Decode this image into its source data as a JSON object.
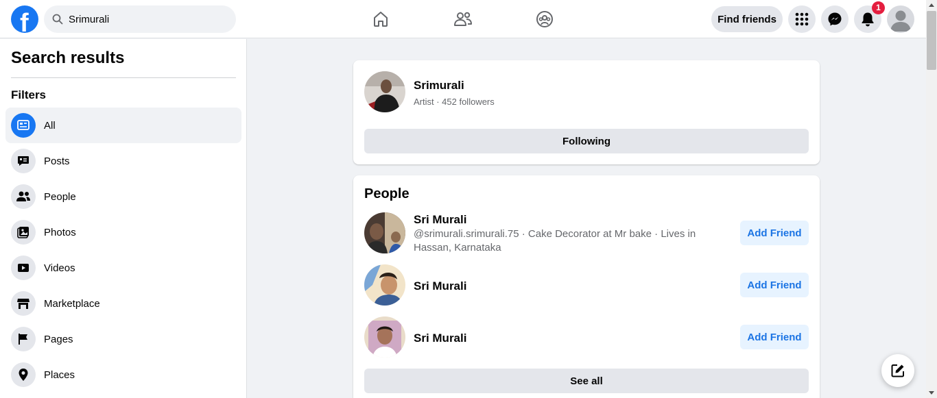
{
  "header": {
    "search_value": "Srimurali",
    "logo_letter": "f",
    "find_friends_label": "Find friends",
    "notification_count": "1"
  },
  "sidebar": {
    "title": "Search results",
    "filters_label": "Filters",
    "items": [
      {
        "label": "All",
        "icon": "feed-icon"
      },
      {
        "label": "Posts",
        "icon": "posts-icon"
      },
      {
        "label": "People",
        "icon": "people-icon"
      },
      {
        "label": "Photos",
        "icon": "photos-icon"
      },
      {
        "label": "Videos",
        "icon": "videos-icon"
      },
      {
        "label": "Marketplace",
        "icon": "marketplace-icon"
      },
      {
        "label": "Pages",
        "icon": "pages-icon"
      },
      {
        "label": "Places",
        "icon": "places-icon"
      }
    ]
  },
  "main": {
    "page_result": {
      "name": "Srimurali",
      "subtitle": "Artist · 452 followers",
      "button_label": "Following"
    },
    "people": {
      "title": "People",
      "results": [
        {
          "name": "Sri Murali",
          "detail": "@srimurali.srimurali.75 · Cake Decorator at Mr bake · Lives in Hassan, Karnataka",
          "button_label": "Add Friend"
        },
        {
          "name": "Sri Murali",
          "detail": "",
          "button_label": "Add Friend"
        },
        {
          "name": "Sri Murali",
          "detail": "",
          "button_label": "Add Friend"
        }
      ],
      "see_all_label": "See all"
    }
  },
  "colors": {
    "brand": "#1877f2",
    "notification": "#e41e3f",
    "add_friend_text": "#1b74e4",
    "add_friend_bg": "#e7f3ff"
  }
}
